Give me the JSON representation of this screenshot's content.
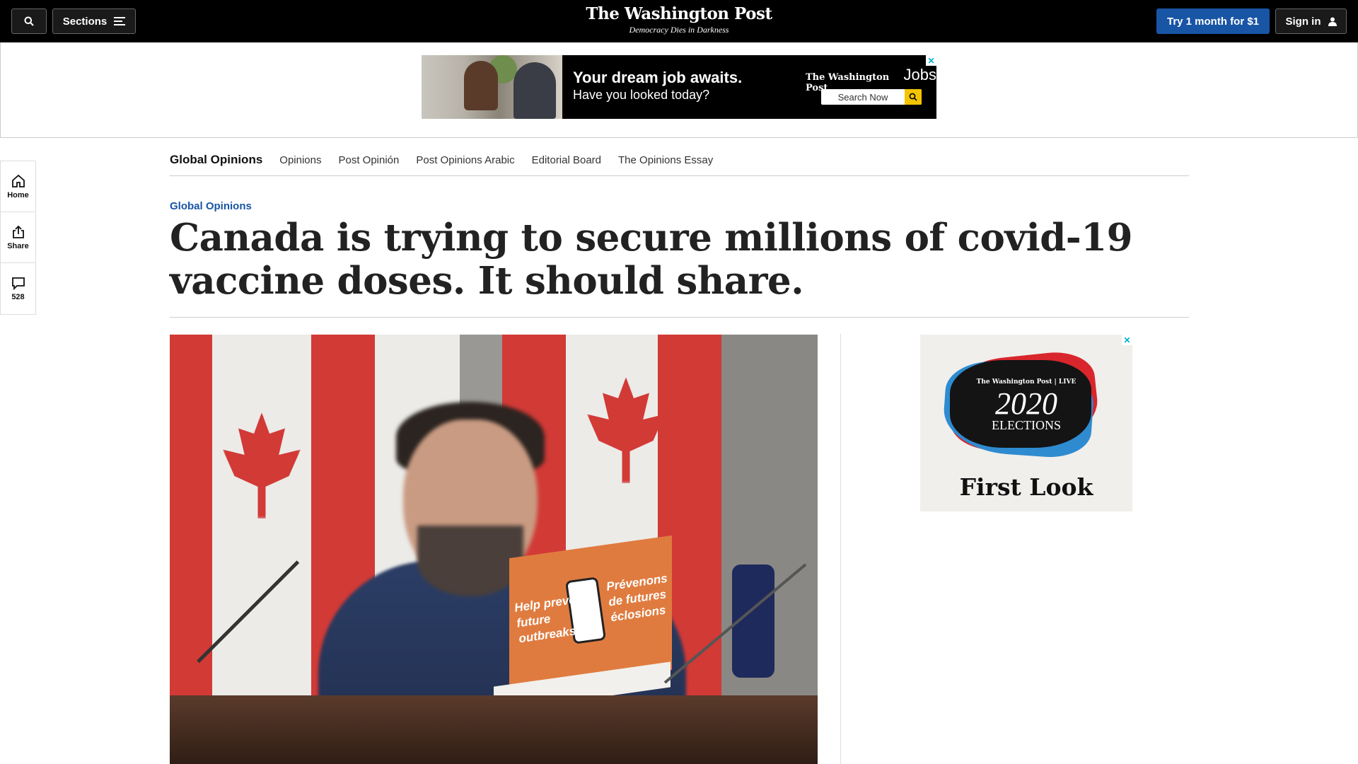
{
  "header": {
    "sections_label": "Sections",
    "logo_name": "The Washington Post",
    "logo_tagline": "Democracy Dies in Darkness",
    "try_label": "Try 1 month for $1",
    "signin_label": "Sign in",
    "accent": "#1955a5"
  },
  "top_ad": {
    "headline": "Your dream job awaits.",
    "subline": "Have you looked today?",
    "brand": "The Washington Post",
    "brand_suffix": "Jobs",
    "search_label": "Search Now",
    "close": "✕"
  },
  "rail": {
    "home_label": "Home",
    "share_label": "Share",
    "comments_count": "528"
  },
  "subnav": {
    "title": "Global Opinions",
    "links": [
      "Opinions",
      "Post Opinión",
      "Post Opinions Arabic",
      "Editorial Board",
      "The Opinions Essay"
    ]
  },
  "article": {
    "kicker": "Global Opinions",
    "headline": "Canada is trying to secure millions of covid-19 vaccine doses. It should share."
  },
  "hero_image": {
    "placard_en": "Help prevent future outbreaks",
    "placard_fr": "Prévenons de futures éclosions"
  },
  "side_ad": {
    "brand": "The Washington Post | LIVE",
    "year": "2020",
    "label": "ELECTIONS",
    "tagline": "First Look",
    "close": "✕"
  }
}
